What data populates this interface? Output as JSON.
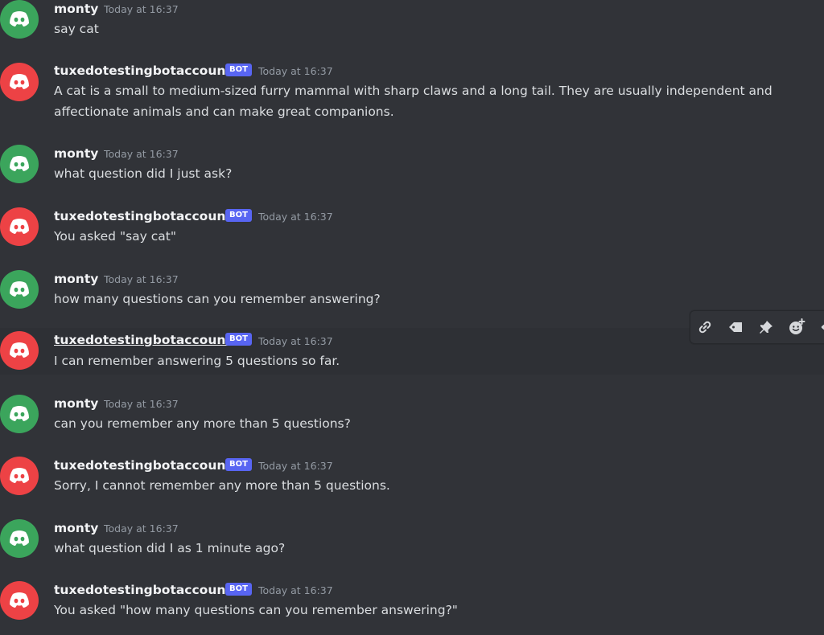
{
  "colors": {
    "background": "#313338",
    "user_avatar": "#3ba55c",
    "bot_avatar": "#ed4245",
    "bot_tag": "#5865f2"
  },
  "messages": [
    {
      "author": "monty",
      "is_bot": false,
      "timestamp": "Today at 16:37",
      "text": "say cat"
    },
    {
      "author": "tuxedotestingbotaccount",
      "is_bot": true,
      "bot_tag": "BOT",
      "timestamp": "Today at 16:37",
      "text": "A cat is a small to medium-sized furry mammal with sharp claws and a long tail. They are usually independent and affectionate animals and can make great companions."
    },
    {
      "author": "monty",
      "is_bot": false,
      "timestamp": "Today at 16:37",
      "text": "what question did I just ask?"
    },
    {
      "author": "tuxedotestingbotaccount",
      "is_bot": true,
      "bot_tag": "BOT",
      "timestamp": "Today at 16:37",
      "text": "You asked \"say cat\""
    },
    {
      "author": "monty",
      "is_bot": false,
      "timestamp": "Today at 16:37",
      "text": "how many questions can you remember answering?"
    },
    {
      "author": "tuxedotestingbotaccount",
      "is_bot": true,
      "bot_tag": "BOT",
      "timestamp": "Today at 16:37",
      "text": "I can remember answering 5 questions so far."
    },
    {
      "author": "monty",
      "is_bot": false,
      "timestamp": "Today at 16:37",
      "text": "can you remember any more than 5 questions?"
    },
    {
      "author": "tuxedotestingbotaccount",
      "is_bot": true,
      "bot_tag": "BOT",
      "timestamp": "Today at 16:37",
      "text": "Sorry, I cannot remember any more than 5 questions."
    },
    {
      "author": "monty",
      "is_bot": false,
      "timestamp": "Today at 16:37",
      "text": "what question did I as 1 minute ago?"
    },
    {
      "author": "tuxedotestingbotaccount",
      "is_bot": true,
      "bot_tag": "BOT",
      "timestamp": "Today at 16:37",
      "text": "You asked \"how many questions can you remember answering?\""
    }
  ],
  "hover_toolbar": {
    "icons": [
      "link-icon",
      "tag-icon",
      "pin-icon",
      "add-reaction-icon",
      "more-icon"
    ]
  }
}
